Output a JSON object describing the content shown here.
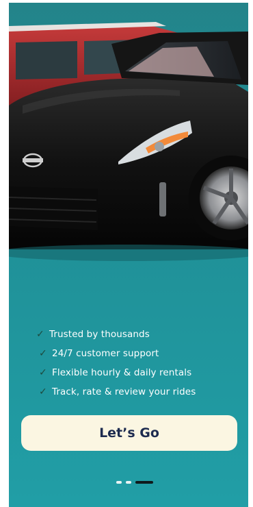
{
  "onboarding": {
    "features": [
      "Trusted by thousands",
      "24/7 customer support",
      "Flexible hourly & daily rentals",
      "Track, rate & review your rides"
    ],
    "check_glyph": "✓",
    "cta_label": "Let’s Go",
    "pager": {
      "current": 3,
      "total": 3
    }
  },
  "colors": {
    "background": "#219ea6",
    "cta_background": "#fbf6e2",
    "cta_text": "#1d2b4f",
    "check": "#1c4a3e"
  }
}
